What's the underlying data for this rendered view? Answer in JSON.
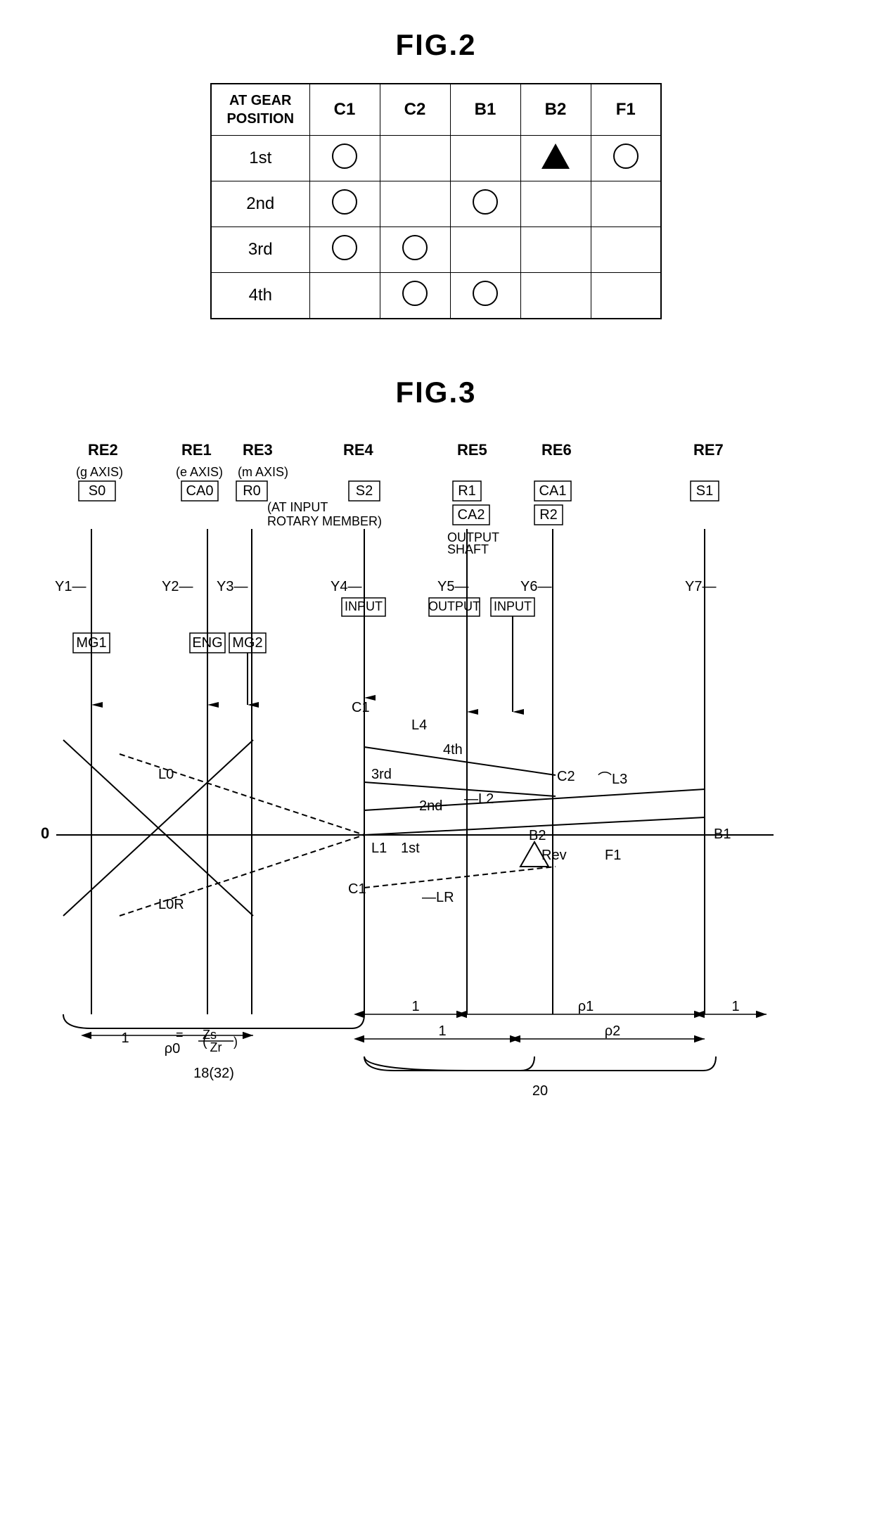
{
  "fig2": {
    "title": "FIG.2",
    "table": {
      "header": {
        "col0": "AT GEAR\nPOSITION",
        "col1": "C1",
        "col2": "C2",
        "col3": "B1",
        "col4": "B2",
        "col5": "F1"
      },
      "rows": [
        {
          "label": "1st",
          "C1": "circle",
          "C2": "",
          "B1": "",
          "B2": "triangle",
          "F1": "circle"
        },
        {
          "label": "2nd",
          "C1": "circle",
          "C2": "",
          "B1": "circle",
          "B2": "",
          "F1": ""
        },
        {
          "label": "3rd",
          "C1": "circle",
          "C2": "circle",
          "B1": "",
          "B2": "",
          "F1": ""
        },
        {
          "label": "4th",
          "C1": "",
          "C2": "circle",
          "B1": "circle",
          "B2": "",
          "F1": ""
        }
      ]
    }
  },
  "fig3": {
    "title": "FIG.3",
    "labels": {
      "RE2": "RE2",
      "RE1": "RE1",
      "RE3": "RE3",
      "RE4": "RE4",
      "RE5": "RE5",
      "RE6": "RE6",
      "RE7": "RE7",
      "g_axis": "(g AXIS)",
      "e_axis": "(e AXIS)",
      "m_axis": "(m AXIS)",
      "S0": "S0",
      "CA0": "CA0",
      "R0": "R0",
      "S2": "S2",
      "R1": "R1",
      "CA1": "CA1",
      "CA2": "CA2",
      "R2": "R2",
      "S1": "S1",
      "at_input": "(AT INPUT\nROTARY MEMBER)",
      "output_shaft": "OUTPUT\nSHAFT",
      "Y1": "Y1",
      "Y2": "Y2",
      "Y3": "Y3",
      "Y4": "Y4",
      "Y5": "Y5",
      "Y6": "Y6",
      "Y7": "Y7",
      "INPUT1": "INPUT",
      "OUTPUT": "OUTPUT",
      "INPUT2": "INPUT",
      "MG1": "MG1",
      "ENG": "ENG",
      "MG2": "MG2",
      "L0": "L0",
      "L0R": "L0R",
      "L1": "L1",
      "L2": "L2",
      "L3": "L3",
      "L4": "L4",
      "LR": "-LR",
      "LR2": "-LR",
      "C1_upper": "C1",
      "C1_lower": "C1",
      "C2_upper": "C2",
      "B2": "B2",
      "B1": "B1",
      "F1": "F1",
      "Rev": "Rev",
      "gear_1st": "1st",
      "gear_2nd": "2nd",
      "gear_3rd": "3rd",
      "gear_4th": "4th",
      "zero": "0",
      "rho0": "ρ0",
      "rho1": "ρ1",
      "rho2": "ρ2",
      "zs_zr": "Zs",
      "zr": "Zr",
      "equals": "=",
      "group1": "18(32)",
      "group2": "20",
      "one_left": "1",
      "one_right1": "1",
      "one_right2": "1",
      "one_bottom": "1"
    }
  }
}
